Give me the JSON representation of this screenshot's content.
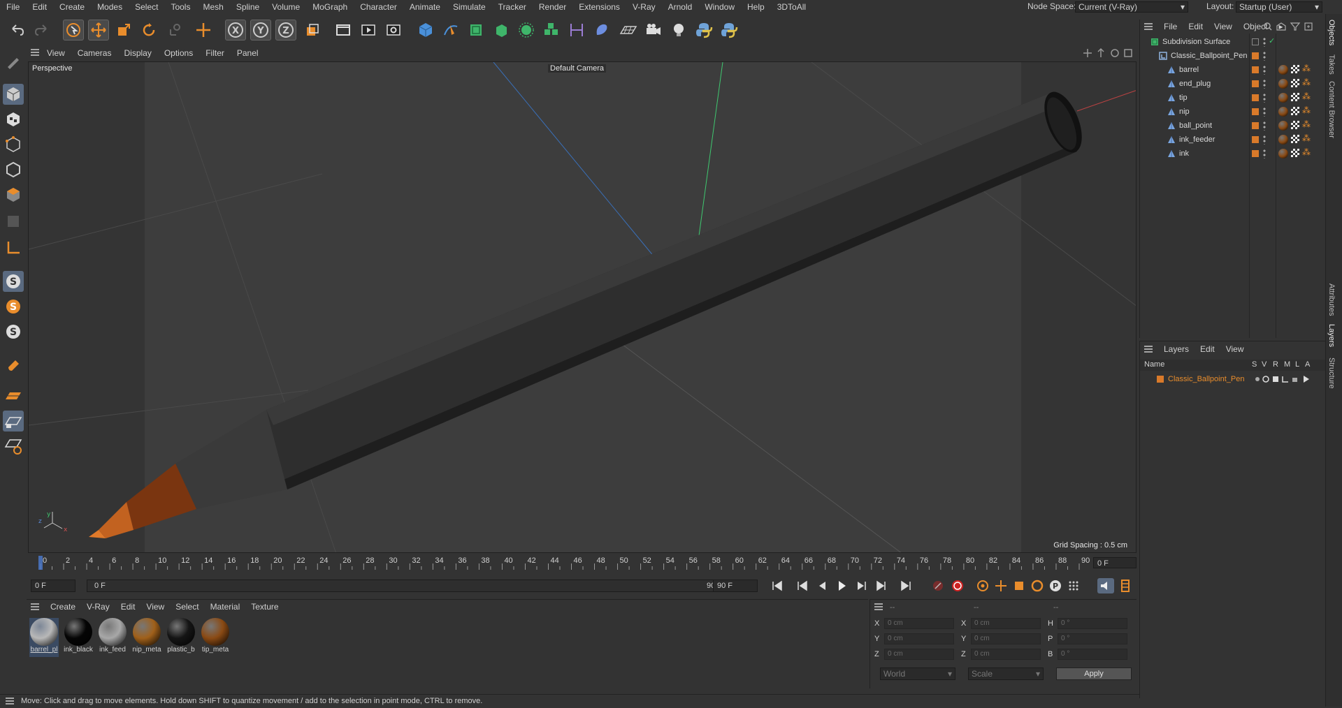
{
  "menubar": {
    "items": [
      "File",
      "Edit",
      "Create",
      "Modes",
      "Select",
      "Tools",
      "Mesh",
      "Spline",
      "Volume",
      "MoGraph",
      "Character",
      "Animate",
      "Simulate",
      "Tracker",
      "Render",
      "Extensions",
      "V-Ray",
      "Arnold",
      "Window",
      "Help",
      "3DToAll"
    ],
    "node_space_label": "Node Space:",
    "node_space_value": "Current (V-Ray)",
    "layout_label": "Layout:",
    "layout_value": "Startup (User)"
  },
  "viewport": {
    "menu": [
      "View",
      "Cameras",
      "Display",
      "Options",
      "Filter",
      "Panel"
    ],
    "view_name": "Perspective",
    "camera": "Default Camera",
    "grid_spacing": "Grid Spacing : 0.5 cm"
  },
  "timeline": {
    "ticks": [
      "0",
      "2",
      "4",
      "6",
      "8",
      "10",
      "12",
      "14",
      "16",
      "18",
      "20",
      "22",
      "24",
      "26",
      "28",
      "30",
      "32",
      "34",
      "36",
      "38",
      "40",
      "42",
      "44",
      "46",
      "48",
      "50",
      "52",
      "54",
      "56",
      "58",
      "60",
      "62",
      "64",
      "66",
      "68",
      "70",
      "72",
      "74",
      "76",
      "78",
      "80",
      "82",
      "84",
      "86",
      "88",
      "90"
    ],
    "current_frame": "0 F",
    "start_field": "0 F",
    "range_start": "0 F",
    "range_end": "90 F",
    "end_field": "90 F"
  },
  "materials": {
    "menu": [
      "Create",
      "V-Ray",
      "Edit",
      "View",
      "Select",
      "Material",
      "Texture"
    ],
    "items": [
      {
        "label": "barrel_pl",
        "color": "#b8b8b8"
      },
      {
        "label": "ink_black",
        "color": "#050505"
      },
      {
        "label": "ink_feed",
        "color": "#a8a8a8"
      },
      {
        "label": "nip_meta",
        "color": "#a0601a"
      },
      {
        "label": "plastic_b",
        "color": "#151515"
      },
      {
        "label": "tip_meta",
        "color": "#8a4a14"
      }
    ]
  },
  "coordinates": {
    "headers": [
      "--",
      "--",
      "--"
    ],
    "rows": [
      {
        "a": "X",
        "av": "0 cm",
        "b": "X",
        "bv": "0 cm",
        "c": "H",
        "cv": "0 °"
      },
      {
        "a": "Y",
        "av": "0 cm",
        "b": "Y",
        "bv": "0 cm",
        "c": "P",
        "cv": "0 °"
      },
      {
        "a": "Z",
        "av": "0 cm",
        "b": "Z",
        "bv": "0 cm",
        "c": "B",
        "cv": "0 °"
      }
    ],
    "space": "World",
    "mode": "Scale",
    "apply_label": "Apply"
  },
  "status": {
    "text": "Move: Click and drag to move elements. Hold down SHIFT to quantize movement / add to the selection in point mode, CTRL to remove."
  },
  "objects": {
    "menu": [
      "File",
      "Edit",
      "View",
      "Object"
    ],
    "tree": [
      {
        "name": "Subdivision Surface",
        "level": 0
      },
      {
        "name": "Classic_Ballpoint_Pen",
        "level": 1
      },
      {
        "name": "barrel",
        "level": 2
      },
      {
        "name": "end_plug",
        "level": 2
      },
      {
        "name": "tip",
        "level": 2
      },
      {
        "name": "nip",
        "level": 2
      },
      {
        "name": "ball_point",
        "level": 2
      },
      {
        "name": "ink_feeder",
        "level": 2
      },
      {
        "name": "ink",
        "level": 2
      }
    ]
  },
  "layers": {
    "menu": [
      "Layers",
      "Edit",
      "View"
    ],
    "columns": [
      "Name",
      "S",
      "V",
      "R",
      "M",
      "L",
      "A"
    ],
    "items": [
      {
        "name": "Classic_Ballpoint_Pen",
        "color": "#d97a2a"
      }
    ]
  },
  "side_tabs": [
    "Objects",
    "Takes",
    "Content Browser",
    "Attributes",
    "Layers",
    "Structure"
  ],
  "colors": {
    "accent": "#d97a2a",
    "selection": "#5a6a80"
  }
}
